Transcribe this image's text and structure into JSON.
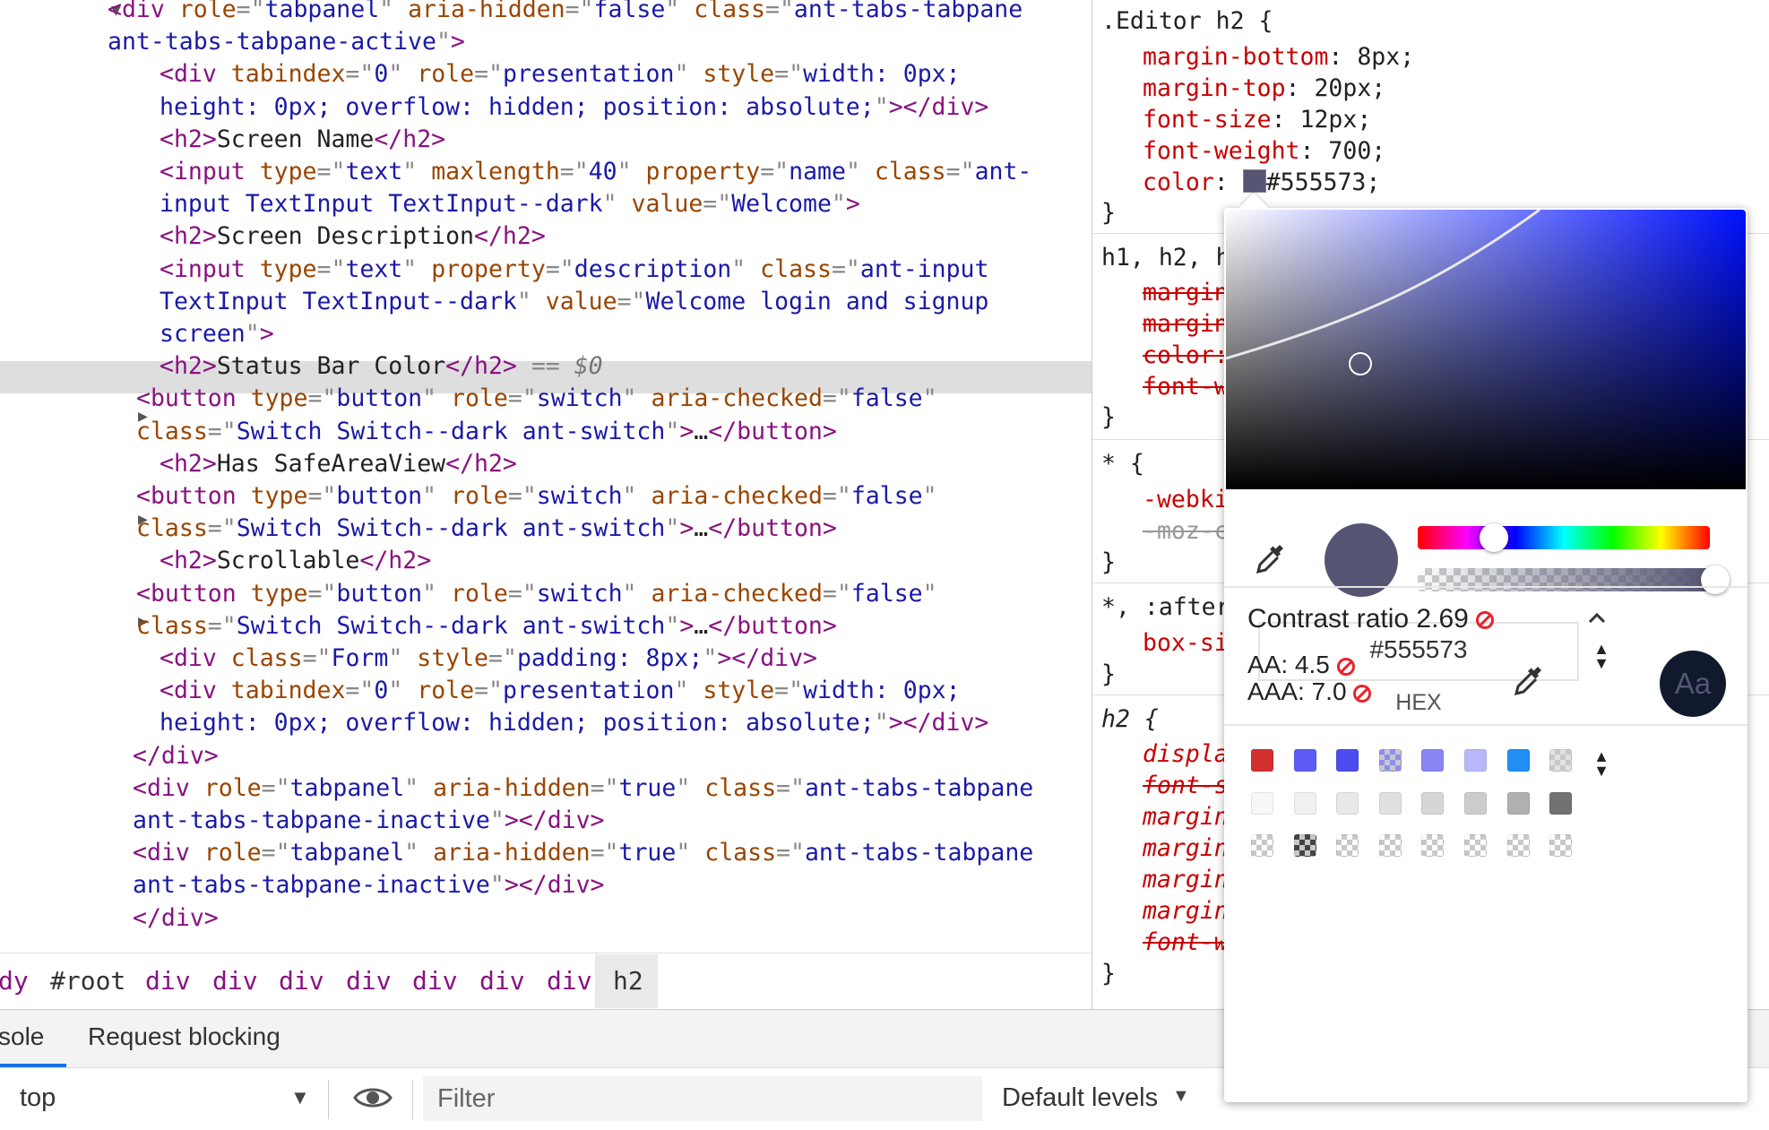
{
  "elements": {
    "lines": [
      [
        [
          "tg",
          "<div "
        ],
        [
          "at",
          "role"
        ],
        [
          "pu",
          "=\""
        ],
        [
          "av",
          "tabpanel"
        ],
        [
          "pu",
          "\" "
        ],
        [
          "at",
          "aria-hidden"
        ],
        [
          "pu",
          "=\""
        ],
        [
          "av",
          "false"
        ],
        [
          "pu",
          "\" "
        ],
        [
          "at",
          "class"
        ],
        [
          "pu",
          "=\""
        ],
        [
          "av",
          "ant-tabs-tabpane"
        ]
      ],
      [
        [
          "av",
          "ant-tabs-tabpane-active"
        ],
        [
          "pu",
          "\""
        ],
        [
          "tg",
          ">"
        ]
      ],
      [
        [
          "tg",
          "<div "
        ],
        [
          "at",
          "tabindex"
        ],
        [
          "pu",
          "=\""
        ],
        [
          "av",
          "0"
        ],
        [
          "pu",
          "\" "
        ],
        [
          "at",
          "role"
        ],
        [
          "pu",
          "=\""
        ],
        [
          "av",
          "presentation"
        ],
        [
          "pu",
          "\" "
        ],
        [
          "at",
          "style"
        ],
        [
          "pu",
          "=\""
        ],
        [
          "av",
          "width: 0px;"
        ]
      ],
      [
        [
          "av",
          "height: 0px; overflow: hidden; position: absolute;"
        ],
        [
          "pu",
          "\""
        ],
        [
          "tg",
          "></div>"
        ]
      ],
      [
        [
          "tg",
          "<h2>"
        ],
        [
          "tx",
          "Screen Name"
        ],
        [
          "tg",
          "</h2>"
        ]
      ],
      [
        [
          "tg",
          "<input "
        ],
        [
          "at",
          "type"
        ],
        [
          "pu",
          "=\""
        ],
        [
          "av",
          "text"
        ],
        [
          "pu",
          "\" "
        ],
        [
          "at",
          "maxlength"
        ],
        [
          "pu",
          "=\""
        ],
        [
          "av",
          "40"
        ],
        [
          "pu",
          "\" "
        ],
        [
          "at",
          "property"
        ],
        [
          "pu",
          "=\""
        ],
        [
          "av",
          "name"
        ],
        [
          "pu",
          "\" "
        ],
        [
          "at",
          "class"
        ],
        [
          "pu",
          "=\""
        ],
        [
          "av",
          "ant-"
        ]
      ],
      [
        [
          "av",
          "input TextInput TextInput--dark"
        ],
        [
          "pu",
          "\" "
        ],
        [
          "at",
          "value"
        ],
        [
          "pu",
          "=\""
        ],
        [
          "av",
          "Welcome"
        ],
        [
          "pu",
          "\""
        ],
        [
          "tg",
          ">"
        ]
      ],
      [
        [
          "tg",
          "<h2>"
        ],
        [
          "tx",
          "Screen Description"
        ],
        [
          "tg",
          "</h2>"
        ]
      ],
      [
        [
          "tg",
          "<input "
        ],
        [
          "at",
          "type"
        ],
        [
          "pu",
          "=\""
        ],
        [
          "av",
          "text"
        ],
        [
          "pu",
          "\" "
        ],
        [
          "at",
          "property"
        ],
        [
          "pu",
          "=\""
        ],
        [
          "av",
          "description"
        ],
        [
          "pu",
          "\" "
        ],
        [
          "at",
          "class"
        ],
        [
          "pu",
          "=\""
        ],
        [
          "av",
          "ant-input"
        ]
      ],
      [
        [
          "av",
          "TextInput TextInput--dark"
        ],
        [
          "pu",
          "\" "
        ],
        [
          "at",
          "value"
        ],
        [
          "pu",
          "=\""
        ],
        [
          "av",
          "Welcome login and signup"
        ]
      ],
      [
        [
          "av",
          "screen"
        ],
        [
          "pu",
          "\""
        ],
        [
          "tg",
          ">"
        ]
      ],
      [
        [
          "tg",
          "<h2>"
        ],
        [
          "tx",
          "Status Bar Color"
        ],
        [
          "tg",
          "</h2>"
        ],
        [
          "pu",
          " == "
        ],
        [
          "dv",
          "$0"
        ]
      ],
      [
        [
          "tg",
          "<button "
        ],
        [
          "at",
          "type"
        ],
        [
          "pu",
          "=\""
        ],
        [
          "av",
          "button"
        ],
        [
          "pu",
          "\" "
        ],
        [
          "at",
          "role"
        ],
        [
          "pu",
          "=\""
        ],
        [
          "av",
          "switch"
        ],
        [
          "pu",
          "\" "
        ],
        [
          "at",
          "aria-checked"
        ],
        [
          "pu",
          "=\""
        ],
        [
          "av",
          "false"
        ],
        [
          "pu",
          "\""
        ]
      ],
      [
        [
          "at",
          "class"
        ],
        [
          "pu",
          "=\""
        ],
        [
          "av",
          "Switch Switch--dark ant-switch"
        ],
        [
          "pu",
          "\""
        ],
        [
          "tg",
          ">"
        ],
        [
          "tx",
          "…"
        ],
        [
          "tg",
          "</button>"
        ]
      ],
      [
        [
          "tg",
          "<h2>"
        ],
        [
          "tx",
          "Has SafeAreaView"
        ],
        [
          "tg",
          "</h2>"
        ]
      ],
      [
        [
          "tg",
          "<button "
        ],
        [
          "at",
          "type"
        ],
        [
          "pu",
          "=\""
        ],
        [
          "av",
          "button"
        ],
        [
          "pu",
          "\" "
        ],
        [
          "at",
          "role"
        ],
        [
          "pu",
          "=\""
        ],
        [
          "av",
          "switch"
        ],
        [
          "pu",
          "\" "
        ],
        [
          "at",
          "aria-checked"
        ],
        [
          "pu",
          "=\""
        ],
        [
          "av",
          "false"
        ],
        [
          "pu",
          "\""
        ]
      ],
      [
        [
          "at",
          "class"
        ],
        [
          "pu",
          "=\""
        ],
        [
          "av",
          "Switch Switch--dark ant-switch"
        ],
        [
          "pu",
          "\""
        ],
        [
          "tg",
          ">"
        ],
        [
          "tx",
          "…"
        ],
        [
          "tg",
          "</button>"
        ]
      ],
      [
        [
          "tg",
          "<h2>"
        ],
        [
          "tx",
          "Scrollable"
        ],
        [
          "tg",
          "</h2>"
        ]
      ],
      [
        [
          "tg",
          "<button "
        ],
        [
          "at",
          "type"
        ],
        [
          "pu",
          "=\""
        ],
        [
          "av",
          "button"
        ],
        [
          "pu",
          "\" "
        ],
        [
          "at",
          "role"
        ],
        [
          "pu",
          "=\""
        ],
        [
          "av",
          "switch"
        ],
        [
          "pu",
          "\" "
        ],
        [
          "at",
          "aria-checked"
        ],
        [
          "pu",
          "=\""
        ],
        [
          "av",
          "false"
        ],
        [
          "pu",
          "\""
        ]
      ],
      [
        [
          "at",
          "class"
        ],
        [
          "pu",
          "=\""
        ],
        [
          "av",
          "Switch Switch--dark ant-switch"
        ],
        [
          "pu",
          "\""
        ],
        [
          "tg",
          ">"
        ],
        [
          "tx",
          "…"
        ],
        [
          "tg",
          "</button>"
        ]
      ],
      [
        [
          "tg",
          "<div "
        ],
        [
          "at",
          "class"
        ],
        [
          "pu",
          "=\""
        ],
        [
          "av",
          "Form"
        ],
        [
          "pu",
          "\" "
        ],
        [
          "at",
          "style"
        ],
        [
          "pu",
          "=\""
        ],
        [
          "av",
          "padding: 8px;"
        ],
        [
          "pu",
          "\""
        ],
        [
          "tg",
          "></div>"
        ]
      ],
      [
        [
          "tg",
          "<div "
        ],
        [
          "at",
          "tabindex"
        ],
        [
          "pu",
          "=\""
        ],
        [
          "av",
          "0"
        ],
        [
          "pu",
          "\" "
        ],
        [
          "at",
          "role"
        ],
        [
          "pu",
          "=\""
        ],
        [
          "av",
          "presentation"
        ],
        [
          "pu",
          "\" "
        ],
        [
          "at",
          "style"
        ],
        [
          "pu",
          "=\""
        ],
        [
          "av",
          "width: 0px;"
        ]
      ],
      [
        [
          "av",
          "height: 0px; overflow: hidden; position: absolute;"
        ],
        [
          "pu",
          "\""
        ],
        [
          "tg",
          "></div>"
        ]
      ],
      [
        [
          "tg",
          "</div>"
        ]
      ],
      [
        [
          "tg",
          "<div "
        ],
        [
          "at",
          "role"
        ],
        [
          "pu",
          "=\""
        ],
        [
          "av",
          "tabpanel"
        ],
        [
          "pu",
          "\" "
        ],
        [
          "at",
          "aria-hidden"
        ],
        [
          "pu",
          "=\""
        ],
        [
          "av",
          "true"
        ],
        [
          "pu",
          "\" "
        ],
        [
          "at",
          "class"
        ],
        [
          "pu",
          "=\""
        ],
        [
          "av",
          "ant-tabs-tabpane"
        ]
      ],
      [
        [
          "av",
          "ant-tabs-tabpane-inactive"
        ],
        [
          "pu",
          "\""
        ],
        [
          "tg",
          "></div>"
        ]
      ],
      [
        [
          "tg",
          "<div "
        ],
        [
          "at",
          "role"
        ],
        [
          "pu",
          "=\""
        ],
        [
          "av",
          "tabpanel"
        ],
        [
          "pu",
          "\" "
        ],
        [
          "at",
          "aria-hidden"
        ],
        [
          "pu",
          "=\""
        ],
        [
          "av",
          "true"
        ],
        [
          "pu",
          "\" "
        ],
        [
          "at",
          "class"
        ],
        [
          "pu",
          "=\""
        ],
        [
          "av",
          "ant-tabs-tabpane"
        ]
      ],
      [
        [
          "av",
          "ant-tabs-tabpane-inactive"
        ],
        [
          "pu",
          "\""
        ],
        [
          "tg",
          "></div>"
        ]
      ],
      [
        [
          "tg",
          "</div>"
        ]
      ]
    ]
  },
  "breadcrumbs": [
    "dy",
    "#root",
    "div",
    "div",
    "div",
    "div",
    "div",
    "div",
    "div",
    "h2"
  ],
  "drawer": {
    "tab_console": "sole",
    "tab_request_blocking": "Request blocking",
    "context": "top",
    "filter_placeholder": "Filter",
    "levels": "Default levels"
  },
  "styles": {
    "rule1_selector": ".Editor h2 {",
    "rule1_props": [
      [
        "margin-bottom",
        "8px;"
      ],
      [
        "margin-top",
        "20px;"
      ],
      [
        "font-size",
        "12px;"
      ],
      [
        "font-weight",
        "700;"
      ],
      [
        "color",
        "#555573;"
      ]
    ],
    "close_brace": "}",
    "rule2_selector": "h1, h2, h",
    "rule2_props": [
      "margin",
      "margin",
      "color:",
      "font-w"
    ],
    "rule3_selector": "* {",
    "rule3_props": [
      "-webki",
      "-moz-c"
    ],
    "rule4_selector": "*, :after",
    "rule4_props": [
      "box-si"
    ],
    "rule5_selector": "h2 {",
    "rule5_props": [
      "displa",
      "font-s",
      "margin",
      "margin",
      "margin",
      "margin",
      "font-w"
    ]
  },
  "picker": {
    "hex_value": "#555573",
    "hex_label": "HEX",
    "contrast_label": "Contrast ratio",
    "contrast_value": "2.69",
    "aa_label": "AA: 4.5",
    "aaa_label": "AAA: 7.0",
    "preview_text": "Aa",
    "current_color": "#555573",
    "hue_fraction": 0.26,
    "palette_row1": [
      "#d32f2f",
      "#5c5cf5",
      "#4c4cf0",
      "checker-blue",
      "#8a85f5",
      "#b8b8f8",
      "#1f8ff5",
      "checker-grey"
    ],
    "palette_row2": [
      "#f7f7f7",
      "#f0f0f0",
      "#e8e8e8",
      "#e0e0e0",
      "#d6d6d6",
      "#cccccc",
      "#b0b0b0",
      "#727272"
    ],
    "palette_row3": [
      "checker",
      "checker-dark",
      "checker",
      "checker",
      "checker",
      "checker",
      "checker",
      "checker"
    ]
  }
}
